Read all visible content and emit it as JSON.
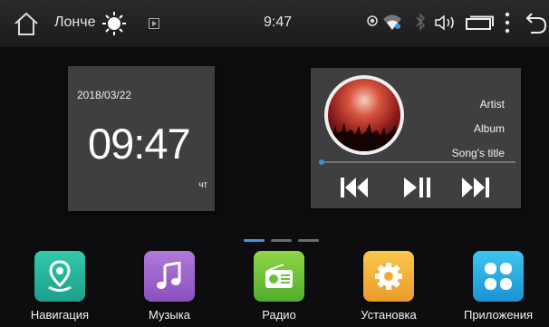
{
  "statusbar": {
    "app_name": "Лонче",
    "time": "9:47"
  },
  "clock": {
    "date": "2018/03/22",
    "time": "09:47",
    "weekday": "чт"
  },
  "music": {
    "artist": "Artist",
    "album": "Album",
    "title": "Song's title",
    "progress": 0.01
  },
  "pager": {
    "pages": 3,
    "active": 0
  },
  "apps": [
    {
      "label": "Навигация",
      "icon": "map-pin-icon",
      "color_top": "#34c9a8",
      "color_bottom": "#1b9f8c"
    },
    {
      "label": "Музыка",
      "icon": "music-note-icon",
      "color_top": "#b17ad8",
      "color_bottom": "#8a4fbe"
    },
    {
      "label": "Радио",
      "icon": "radio-icon",
      "color_top": "#8fd648",
      "color_bottom": "#52ad2b"
    },
    {
      "label": "Установка",
      "icon": "gear-icon",
      "color_top": "#f7c94d",
      "color_bottom": "#eb9a28"
    },
    {
      "label": "Приложения",
      "icon": "grid-icon",
      "color_top": "#3ec5ee",
      "color_bottom": "#1b93d3"
    }
  ],
  "colors": {
    "accent": "#3a9ae8",
    "card": "#3f3f41",
    "background": "#0d0d0f"
  }
}
